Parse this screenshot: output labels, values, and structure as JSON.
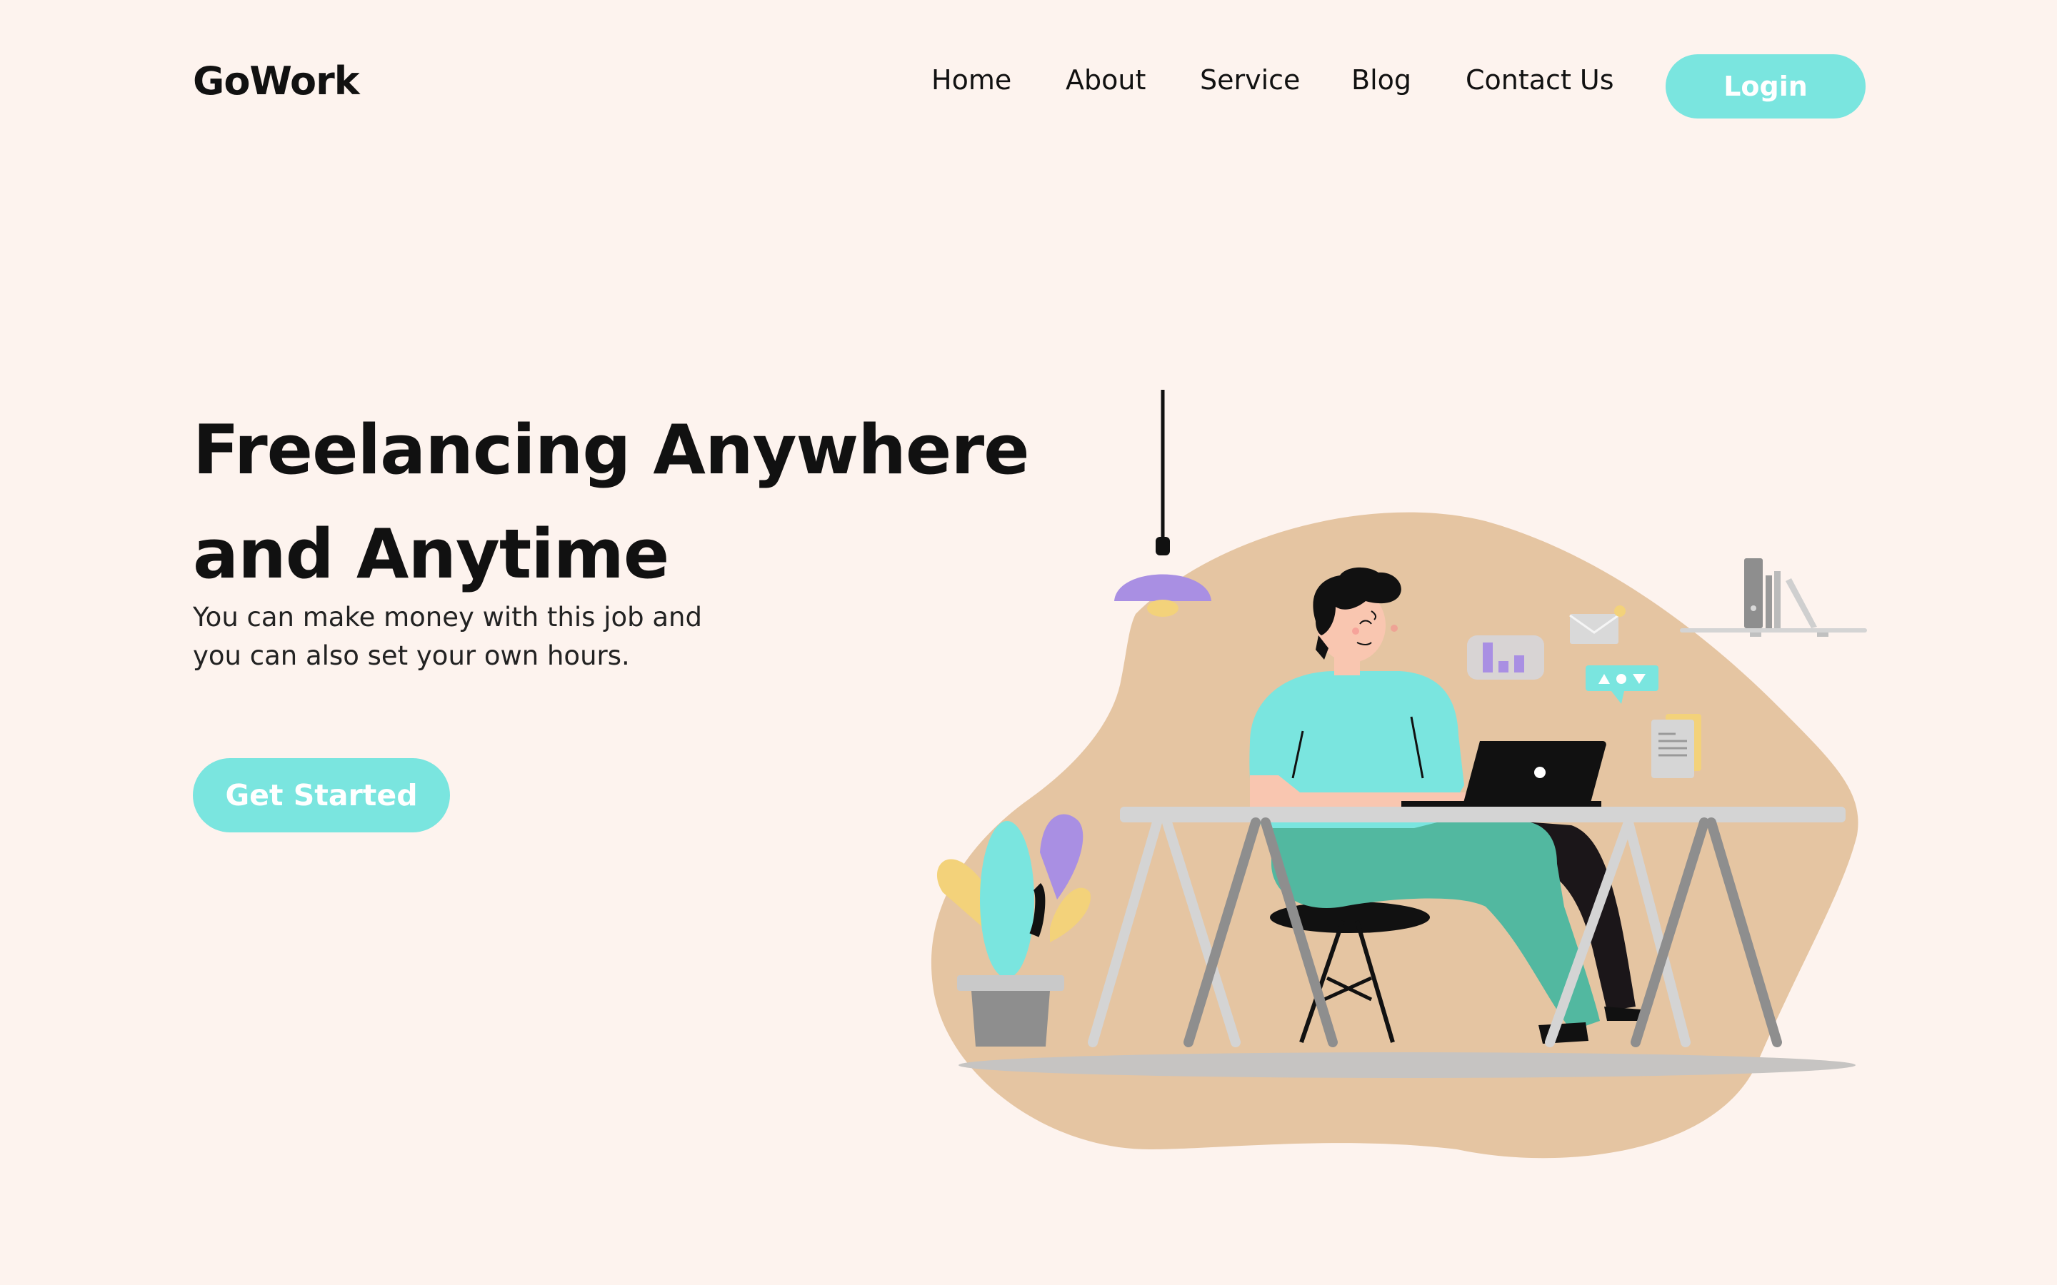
{
  "header": {
    "logo": "GoWork",
    "nav": [
      "Home",
      "About",
      "Service",
      "Blog",
      "Contact Us"
    ],
    "login_label": "Login"
  },
  "hero": {
    "title_line1": "Freelancing Anywhere",
    "title_line2": "and Anytime",
    "subtitle_line1": "You can make money with this job and",
    "subtitle_line2": "you can also set your own hours.",
    "cta_label": "Get Started"
  },
  "colors": {
    "background": "#fdf3ee",
    "accent": "#7ae5df",
    "blob": "#e5c5a2",
    "purple": "#a98fe3",
    "pants": "#52b8a0"
  },
  "illustration": {
    "icons": [
      "lamp-icon",
      "plant-icon",
      "laptop-icon",
      "email-icon",
      "bar-chart-icon",
      "chat-bubble-icon",
      "document-icon",
      "bookshelf-icon"
    ]
  }
}
